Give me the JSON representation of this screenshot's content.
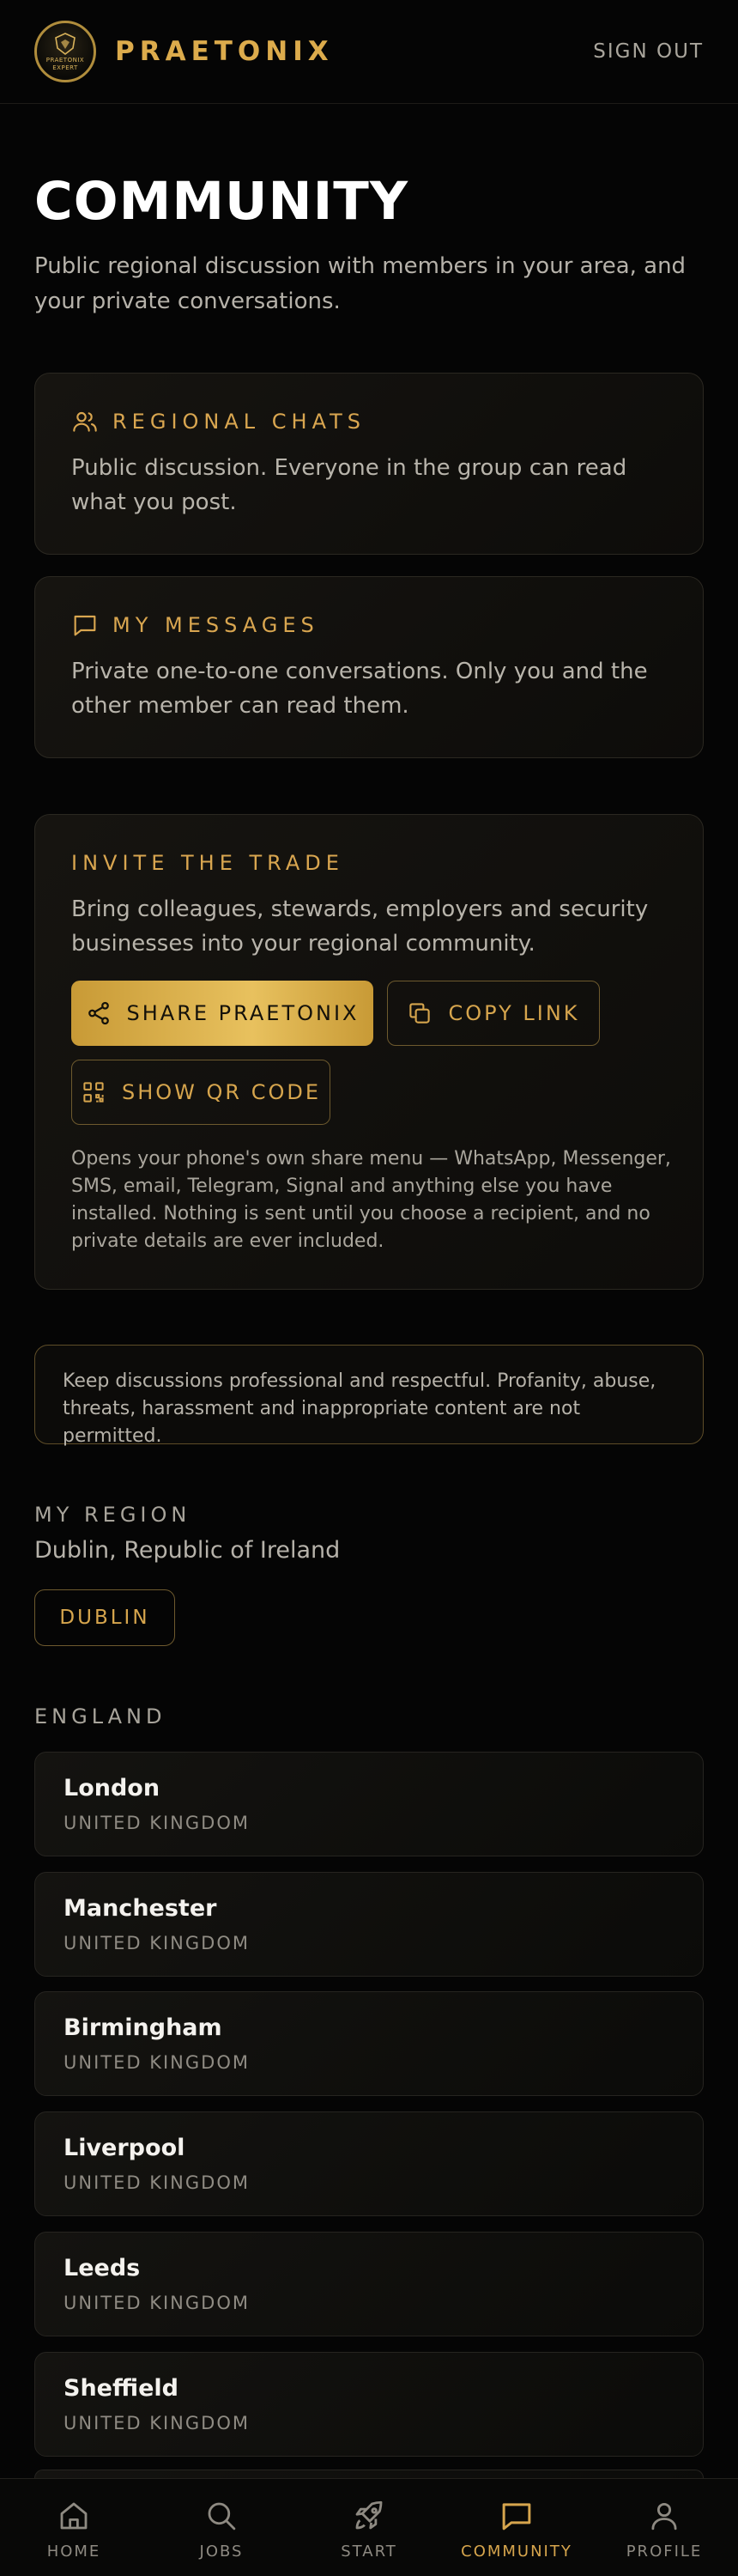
{
  "header": {
    "logo_text": "PRAETONIX",
    "logo_subtext": "EXPERT",
    "brand": "PRAETONIX",
    "sign_out_label": "SIGN OUT"
  },
  "page": {
    "title": "COMMUNITY",
    "subtitle": "Public regional discussion with members in your area, and your private conversations."
  },
  "regional_chats": {
    "label": "REGIONAL CHATS",
    "description": "Public discussion. Everyone in the group can read what you post."
  },
  "my_messages": {
    "label": "MY MESSAGES",
    "description": "Private one-to-one conversations. Only you and the other member can read them."
  },
  "invite": {
    "label": "INVITE THE TRADE",
    "description": "Bring colleagues, stewards, employers and security businesses into your regional community.",
    "share_label": "SHARE PRAETONIX",
    "copy_label": "COPY LINK",
    "qr_label": "SHOW QR CODE",
    "note": "Opens your phone's own share menu — WhatsApp, Messenger, SMS, email, Telegram, Signal and anything else you have installed. Nothing is sent until you choose a recipient, and no private details are ever included."
  },
  "rules_notice": "Keep discussions professional and respectful. Profanity, abuse, threats, harassment and inappropriate content are not permitted.",
  "my_region": {
    "label": "MY REGION",
    "name": "Dublin, Republic of Ireland",
    "chip": "DUBLIN"
  },
  "england": {
    "label": "ENGLAND",
    "cities": [
      {
        "name": "London",
        "country": "UNITED KINGDOM"
      },
      {
        "name": "Manchester",
        "country": "UNITED KINGDOM"
      },
      {
        "name": "Birmingham",
        "country": "UNITED KINGDOM"
      },
      {
        "name": "Liverpool",
        "country": "UNITED KINGDOM"
      },
      {
        "name": "Leeds",
        "country": "UNITED KINGDOM"
      },
      {
        "name": "Sheffield",
        "country": "UNITED KINGDOM"
      }
    ]
  },
  "nav": {
    "items": [
      {
        "label": "HOME",
        "icon": "home-icon"
      },
      {
        "label": "JOBS",
        "icon": "search-icon"
      },
      {
        "label": "START",
        "icon": "rocket-icon"
      },
      {
        "label": "COMMUNITY",
        "icon": "message-icon"
      },
      {
        "label": "PROFILE",
        "icon": "user-icon"
      }
    ],
    "active": "COMMUNITY"
  },
  "colors": {
    "accent": "#d6a54d",
    "background": "#050505",
    "nav_inactive": "#8e8a82"
  }
}
